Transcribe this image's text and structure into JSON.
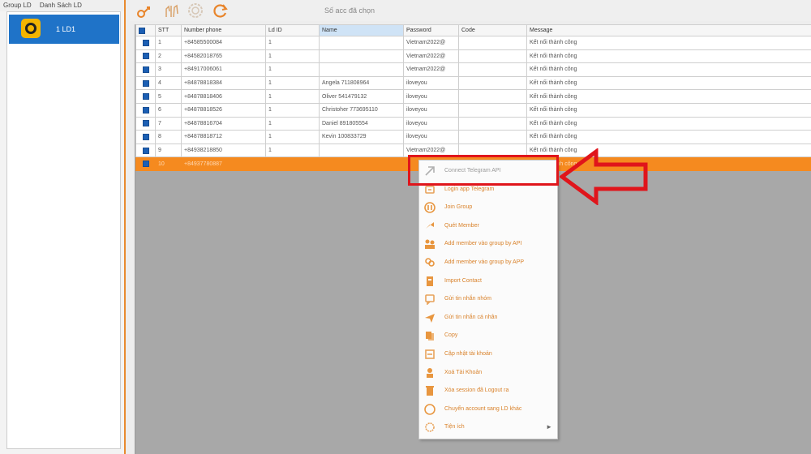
{
  "left_panel": {
    "tabs": [
      "Group LD",
      "Danh Sách LD"
    ],
    "group_item": {
      "label": "1 LD1"
    }
  },
  "toolbar": {
    "count_text": "Số acc đã chọn",
    "icons": [
      "import-icon",
      "hands-icon",
      "settings-gear-icon",
      "refresh-icon"
    ]
  },
  "table": {
    "columns": [
      "",
      "STT",
      "Number phone",
      "Ld ID",
      "Name",
      "Password",
      "Code",
      "Message"
    ],
    "selected_column": "Name",
    "rows": [
      {
        "stt": "1",
        "phone": "+84585500084",
        "ldid": "1",
        "name": "",
        "password": "Vietnam2022@",
        "code": "",
        "message": "Kết nối thành công"
      },
      {
        "stt": "2",
        "phone": "+84582018765",
        "ldid": "1",
        "name": "",
        "password": "Vietnam2022@",
        "code": "",
        "message": "Kết nối thành công"
      },
      {
        "stt": "3",
        "phone": "+84917006061",
        "ldid": "1",
        "name": "",
        "password": "Vietnam2022@",
        "code": "",
        "message": "Kết nối thành công"
      },
      {
        "stt": "4",
        "phone": "+84878818384",
        "ldid": "1",
        "name": "Angela 711808964",
        "password": "iloveyou",
        "code": "",
        "message": "Kết nối thành công"
      },
      {
        "stt": "5",
        "phone": "+84878818406",
        "ldid": "1",
        "name": "Oliver 541479132",
        "password": "iloveyou",
        "code": "",
        "message": "Kết nối thành công"
      },
      {
        "stt": "6",
        "phone": "+84878818526",
        "ldid": "1",
        "name": "Christoher 773695110",
        "password": "iloveyou",
        "code": "",
        "message": "Kết nối thành công"
      },
      {
        "stt": "7",
        "phone": "+84878816704",
        "ldid": "1",
        "name": "Daniel 891805554",
        "password": "iloveyou",
        "code": "",
        "message": "Kết nối thành công"
      },
      {
        "stt": "8",
        "phone": "+84878818712",
        "ldid": "1",
        "name": "Kevin 100833729",
        "password": "iloveyou",
        "code": "",
        "message": "Kết nối thành công"
      },
      {
        "stt": "9",
        "phone": "+84938218850",
        "ldid": "1",
        "name": "",
        "password": "Vietnam2022@",
        "code": "",
        "message": "Kết nối thành công"
      },
      {
        "stt": "10",
        "phone": "+84937780887",
        "ldid": "",
        "name": "",
        "password": "",
        "code": "",
        "message": "Kết nối thành công"
      }
    ]
  },
  "context_menu": {
    "items": [
      {
        "label": "Connect Telegram API",
        "icon": "connect-icon",
        "color": "#b0b0b0"
      },
      {
        "label": "Login app Telegram",
        "icon": "login-icon",
        "color": "#e8a25a"
      },
      {
        "label": "Join Group",
        "icon": "join-icon",
        "color": "#e8963f"
      },
      {
        "label": "Quét Member",
        "icon": "scan-icon",
        "color": "#e8963f"
      },
      {
        "label": "Add member vào group by API",
        "icon": "users-icon",
        "color": "#e8963f"
      },
      {
        "label": "Add member vào group by APP",
        "icon": "users-app-icon",
        "color": "#e8963f"
      },
      {
        "label": "Import Contact",
        "icon": "import-contact-icon",
        "color": "#e8963f"
      },
      {
        "label": "Gửi tin nhắn nhóm",
        "icon": "message-icon",
        "color": "#e8a25a"
      },
      {
        "label": "Gửi tin nhắn cá nhân",
        "icon": "send-icon",
        "color": "#e8963f"
      },
      {
        "label": "Copy",
        "icon": "copy-icon",
        "color": "#e8963f"
      },
      {
        "label": "Cập nhật tài khoản",
        "icon": "update-icon",
        "color": "#e8a25a"
      },
      {
        "label": "Xoá Tài Khoản",
        "icon": "delete-user-icon",
        "color": "#e8963f"
      },
      {
        "label": "Xóa session đã Logout ra",
        "icon": "trash-icon",
        "color": "#e8963f"
      },
      {
        "label": "Chuyển account sang LD khác",
        "icon": "transfer-icon",
        "color": "#e8963f"
      },
      {
        "label": "Tiện ích",
        "icon": "utility-icon",
        "color": "#e8a25a",
        "has_submenu": true
      }
    ],
    "submenu_arrow": "►"
  },
  "colors": {
    "accent": "#f58a1f",
    "selection": "#1f73c8",
    "annotation": "#e0151b"
  }
}
